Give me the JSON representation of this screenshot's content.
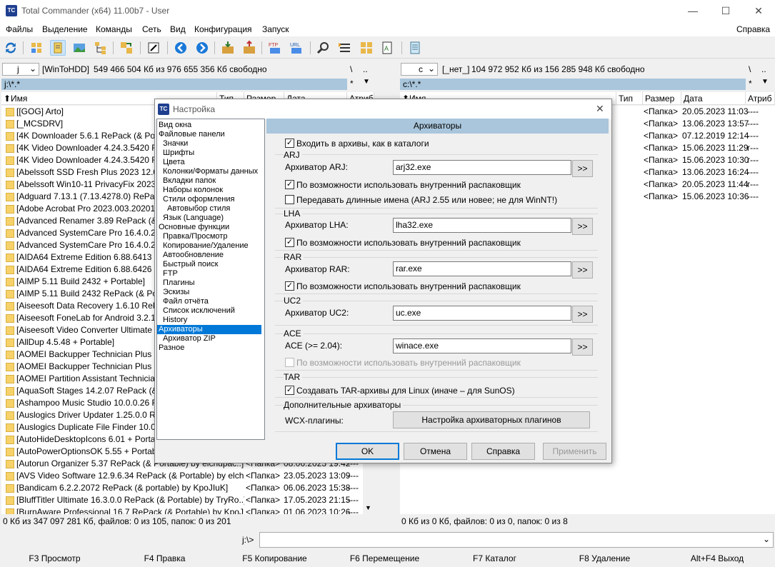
{
  "window": {
    "title": "Total Commander (x64) 11.00b7 - User",
    "minimize": "—",
    "maximize": "☐",
    "close": "✕",
    "icon": "TC"
  },
  "menu": {
    "items": [
      "Файлы",
      "Выделение",
      "Команды",
      "Сеть",
      "Вид",
      "Конфигурация",
      "Запуск"
    ],
    "help": "Справка"
  },
  "toolbar": {
    "icons": [
      "refresh-icon",
      "brief-view-icon",
      "detailed-view-icon",
      "thumbnails-icon",
      "tree-view-icon",
      "select-files-icon",
      "invert-selection-icon",
      "back-icon",
      "forward-icon",
      "pack-icon",
      "unpack-icon",
      "ftp-connect-icon",
      "url-connect-icon",
      "search-icon",
      "multi-rename-icon",
      "sync-dirs-icon",
      "compare-files-icon",
      "notepad-icon"
    ]
  },
  "left": {
    "drive": "j",
    "volume": "[WinToHDD]",
    "free": "549 466 504 Кб из 976 655 356 Кб свободно",
    "root": "\\",
    "up": "..",
    "path": "j:\\*.*",
    "star": "*",
    "columns": [
      "⬆Имя",
      "Тип",
      "Размер",
      "Дата",
      "Атриб"
    ],
    "files": [
      {
        "name": "[[GOG] Arto]",
        "size": "",
        "date": "",
        "attr": ""
      },
      {
        "name": "[_MCSDRV]",
        "size": "",
        "date": "",
        "attr": ""
      },
      {
        "name": "[4K Downloader 5.6.1 RePack (& Port",
        "size": "",
        "date": "",
        "attr": ""
      },
      {
        "name": "[4K Video Downloader 4.24.3.5420 Re",
        "size": "",
        "date": "",
        "attr": ""
      },
      {
        "name": "[4K Video Downloader 4.24.3.5420 Re",
        "size": "",
        "date": "",
        "attr": ""
      },
      {
        "name": "[Abelssoft SSD Fresh Plus 2023 12.08.4",
        "size": "",
        "date": "",
        "attr": ""
      },
      {
        "name": "[Abelssoft Win10-11 PrivacyFix 2023 5",
        "size": "",
        "date": "",
        "attr": ""
      },
      {
        "name": "[Adguard 7.13.1 (7.13.4278.0) RePack",
        "size": "",
        "date": "",
        "attr": ""
      },
      {
        "name": "[Adobe Acrobat Pro 2023.003.20201 R",
        "size": "",
        "date": "",
        "attr": ""
      },
      {
        "name": "[Advanced Renamer 3.89 RePack (& P",
        "size": "",
        "date": "",
        "attr": ""
      },
      {
        "name": "[Advanced SystemCare Pro 16.4.0.225",
        "size": "",
        "date": "",
        "attr": ""
      },
      {
        "name": "[Advanced SystemCare Pro 16.4.0.225",
        "size": "",
        "date": "",
        "attr": ""
      },
      {
        "name": "[AIDA64 Extreme Edition 6.88.6413 Be",
        "size": "",
        "date": "",
        "attr": ""
      },
      {
        "name": "[AIDA64 Extreme Edition 6.88.6426 Be",
        "size": "",
        "date": "",
        "attr": ""
      },
      {
        "name": "[AIMP 5.11 Build 2432 + Portable]",
        "size": "",
        "date": "",
        "attr": ""
      },
      {
        "name": "[AIMP 5.11 Build 2432 RePack (& Port",
        "size": "",
        "date": "",
        "attr": ""
      },
      {
        "name": "[Aiseesoft Data Recovery 1.6.10 RePac",
        "size": "",
        "date": "",
        "attr": ""
      },
      {
        "name": "[Aiseesoft FoneLab for Android 3.2.18",
        "size": "",
        "date": "",
        "attr": ""
      },
      {
        "name": "[Aiseesoft Video Converter Ultimate 1",
        "size": "",
        "date": "",
        "attr": ""
      },
      {
        "name": "[AllDup 4.5.48 + Portable]",
        "size": "",
        "date": "",
        "attr": ""
      },
      {
        "name": "[AOMEI Backupper Technician Plus 7.",
        "size": "",
        "date": "",
        "attr": ""
      },
      {
        "name": "[AOMEI Backupper Technician Plus 7.",
        "size": "",
        "date": "",
        "attr": ""
      },
      {
        "name": "[AOMEI Partition Assistant Technician",
        "size": "",
        "date": "",
        "attr": ""
      },
      {
        "name": "[AquaSoft Stages 14.2.07 RePack (& P",
        "size": "",
        "date": "",
        "attr": ""
      },
      {
        "name": "[Ashampoo Music Studio 10.0.0.26 Re",
        "size": "",
        "date": "",
        "attr": ""
      },
      {
        "name": "[Auslogics Driver Updater 1.25.0.0 Rel",
        "size": "",
        "date": "",
        "attr": ""
      },
      {
        "name": "[Auslogics Duplicate File Finder 10.0.0",
        "size": "",
        "date": "",
        "attr": ""
      },
      {
        "name": "[AutoHideDesktopIcons 6.01 + Portal",
        "size": "",
        "date": "",
        "attr": ""
      },
      {
        "name": "[AutoPowerOptionsOK 5.55 + Portabl",
        "size": "",
        "date": "",
        "attr": ""
      },
      {
        "name": "[Autorun Organizer 5.37 RePack (& Portable) by elchupac..]",
        "size": "<Папка>",
        "date": "08.06.2023 19:42",
        "attr": "----"
      },
      {
        "name": "[AVS Video Software 12.9.6.34 RePack (& Portable) by elch..]",
        "size": "<Папка>",
        "date": "23.05.2023 13:09",
        "attr": "----"
      },
      {
        "name": "[Bandicam 6.2.2.2072 RePack (& portable) by KpoJIuK]",
        "size": "<Папка>",
        "date": "06.06.2023 15:38",
        "attr": "----"
      },
      {
        "name": "[BluffTitler Ultimate 16.3.0.0 RePack (& Portable) by TryRo..]",
        "size": "<Папка>",
        "date": "17.05.2023 21:15",
        "attr": "----"
      },
      {
        "name": "[BurnAware Professional 16.7 RePack (& Portable) by KpoJI..]",
        "size": "<Папка>",
        "date": "01.06.2023 10:26",
        "attr": "----"
      }
    ],
    "status": "0 Кб из 347 097 281 Кб, файлов: 0 из 105, папок: 0 из 201"
  },
  "right": {
    "drive": "c",
    "volume": "[_нет_]",
    "free": "104 972 952 Кб из 156 285 948 Кб свободно",
    "root": "\\",
    "up": "..",
    "path": "c:\\*.*",
    "star": "*",
    "columns": [
      "⬆Имя",
      "Тип",
      "Размер",
      "Дата",
      "Атриб"
    ],
    "files": [
      {
        "size": "<Папка>",
        "date": "20.05.2023 11:03",
        "attr": "----"
      },
      {
        "size": "<Папка>",
        "date": "13.06.2023 13:57",
        "attr": "----"
      },
      {
        "size": "<Папка>",
        "date": "07.12.2019 12:14",
        "attr": "----"
      },
      {
        "size": "<Папка>",
        "date": "15.06.2023 11:29",
        "attr": "r---"
      },
      {
        "size": "<Папка>",
        "date": "15.06.2023 10:30",
        "attr": "r---"
      },
      {
        "size": "<Папка>",
        "date": "13.06.2023 16:24",
        "attr": "----"
      },
      {
        "size": "<Папка>",
        "date": "20.05.2023 11:44",
        "attr": "r---"
      },
      {
        "size": "<Папка>",
        "date": "15.06.2023 10:36",
        "attr": "----"
      }
    ],
    "status": "0 Кб из 0 Кб, файлов: 0 из 0, папок: 0 из 8"
  },
  "cmdline": {
    "prompt": "j:\\>",
    "value": ""
  },
  "fkeys": [
    "F3 Просмотр",
    "F4 Правка",
    "F5 Копирование",
    "F6 Перемещение",
    "F7 Каталог",
    "F8 Удаление",
    "Alt+F4 Выход"
  ],
  "dialog": {
    "title": "Настройка",
    "close": "✕",
    "page_title": "Архиваторы",
    "tree": [
      {
        "label": "Вид окна",
        "indent": 0
      },
      {
        "label": "Файловые панели",
        "indent": 0
      },
      {
        "label": "Значки",
        "indent": 1
      },
      {
        "label": "Шрифты",
        "indent": 1
      },
      {
        "label": "Цвета",
        "indent": 1
      },
      {
        "label": "Колонки/Форматы данных",
        "indent": 1
      },
      {
        "label": "Вкладки папок",
        "indent": 1
      },
      {
        "label": "Наборы колонок",
        "indent": 1
      },
      {
        "label": "Стили оформления",
        "indent": 1
      },
      {
        "label": "Автовыбор стиля",
        "indent": 2
      },
      {
        "label": "Язык (Language)",
        "indent": 1
      },
      {
        "label": "Основные функции",
        "indent": 0
      },
      {
        "label": "Правка/Просмотр",
        "indent": 1
      },
      {
        "label": "Копирование/Удаление",
        "indent": 1
      },
      {
        "label": "Автообновление",
        "indent": 1
      },
      {
        "label": "Быстрый поиск",
        "indent": 1
      },
      {
        "label": "FTP",
        "indent": 1
      },
      {
        "label": "Плагины",
        "indent": 1
      },
      {
        "label": "Эскизы",
        "indent": 1
      },
      {
        "label": "Файл отчёта",
        "indent": 1
      },
      {
        "label": "Список исключений",
        "indent": 1
      },
      {
        "label": "History",
        "indent": 1
      },
      {
        "label": "Архиваторы",
        "indent": 0,
        "selected": true
      },
      {
        "label": "Архиватор ZIP",
        "indent": 1
      },
      {
        "label": "Разное",
        "indent": 0
      }
    ],
    "enter_archives": "Входить в архивы, как в каталоги",
    "arj": {
      "group": "ARJ",
      "label": "Архиватор ARJ:",
      "value": "arj32.exe",
      "internal": "По возможности использовать внутренний распаковщик",
      "longnames": "Передавать длинные имена (ARJ 2.55 или новее; не для WinNT!)"
    },
    "lha": {
      "group": "LHA",
      "label": "Архиватор LHA:",
      "value": "lha32.exe",
      "internal": "По возможности использовать внутренний распаковщик"
    },
    "rar": {
      "group": "RAR",
      "label": "Архиватор RAR:",
      "value": "rar.exe",
      "internal": "По возможности использовать внутренний распаковщик"
    },
    "uc2": {
      "group": "UC2",
      "label": "Архиватор UC2:",
      "value": "uc.exe"
    },
    "ace": {
      "group": "ACE",
      "label": "ACE (>= 2.04):",
      "value": "winace.exe",
      "internal": "По возможности использовать внутренний распаковщик"
    },
    "tar": {
      "group": "TAR",
      "option": "Создавать TAR-архивы для Linux (иначе – для SunOS)"
    },
    "extra": {
      "group": "Дополнительные архиваторы",
      "label": "WCX-плагины:",
      "button": "Настройка архиваторных плагинов"
    },
    "browse": ">>",
    "check": "✓",
    "buttons": {
      "ok": "OK",
      "cancel": "Отмена",
      "help": "Справка",
      "apply": "Применить"
    }
  }
}
